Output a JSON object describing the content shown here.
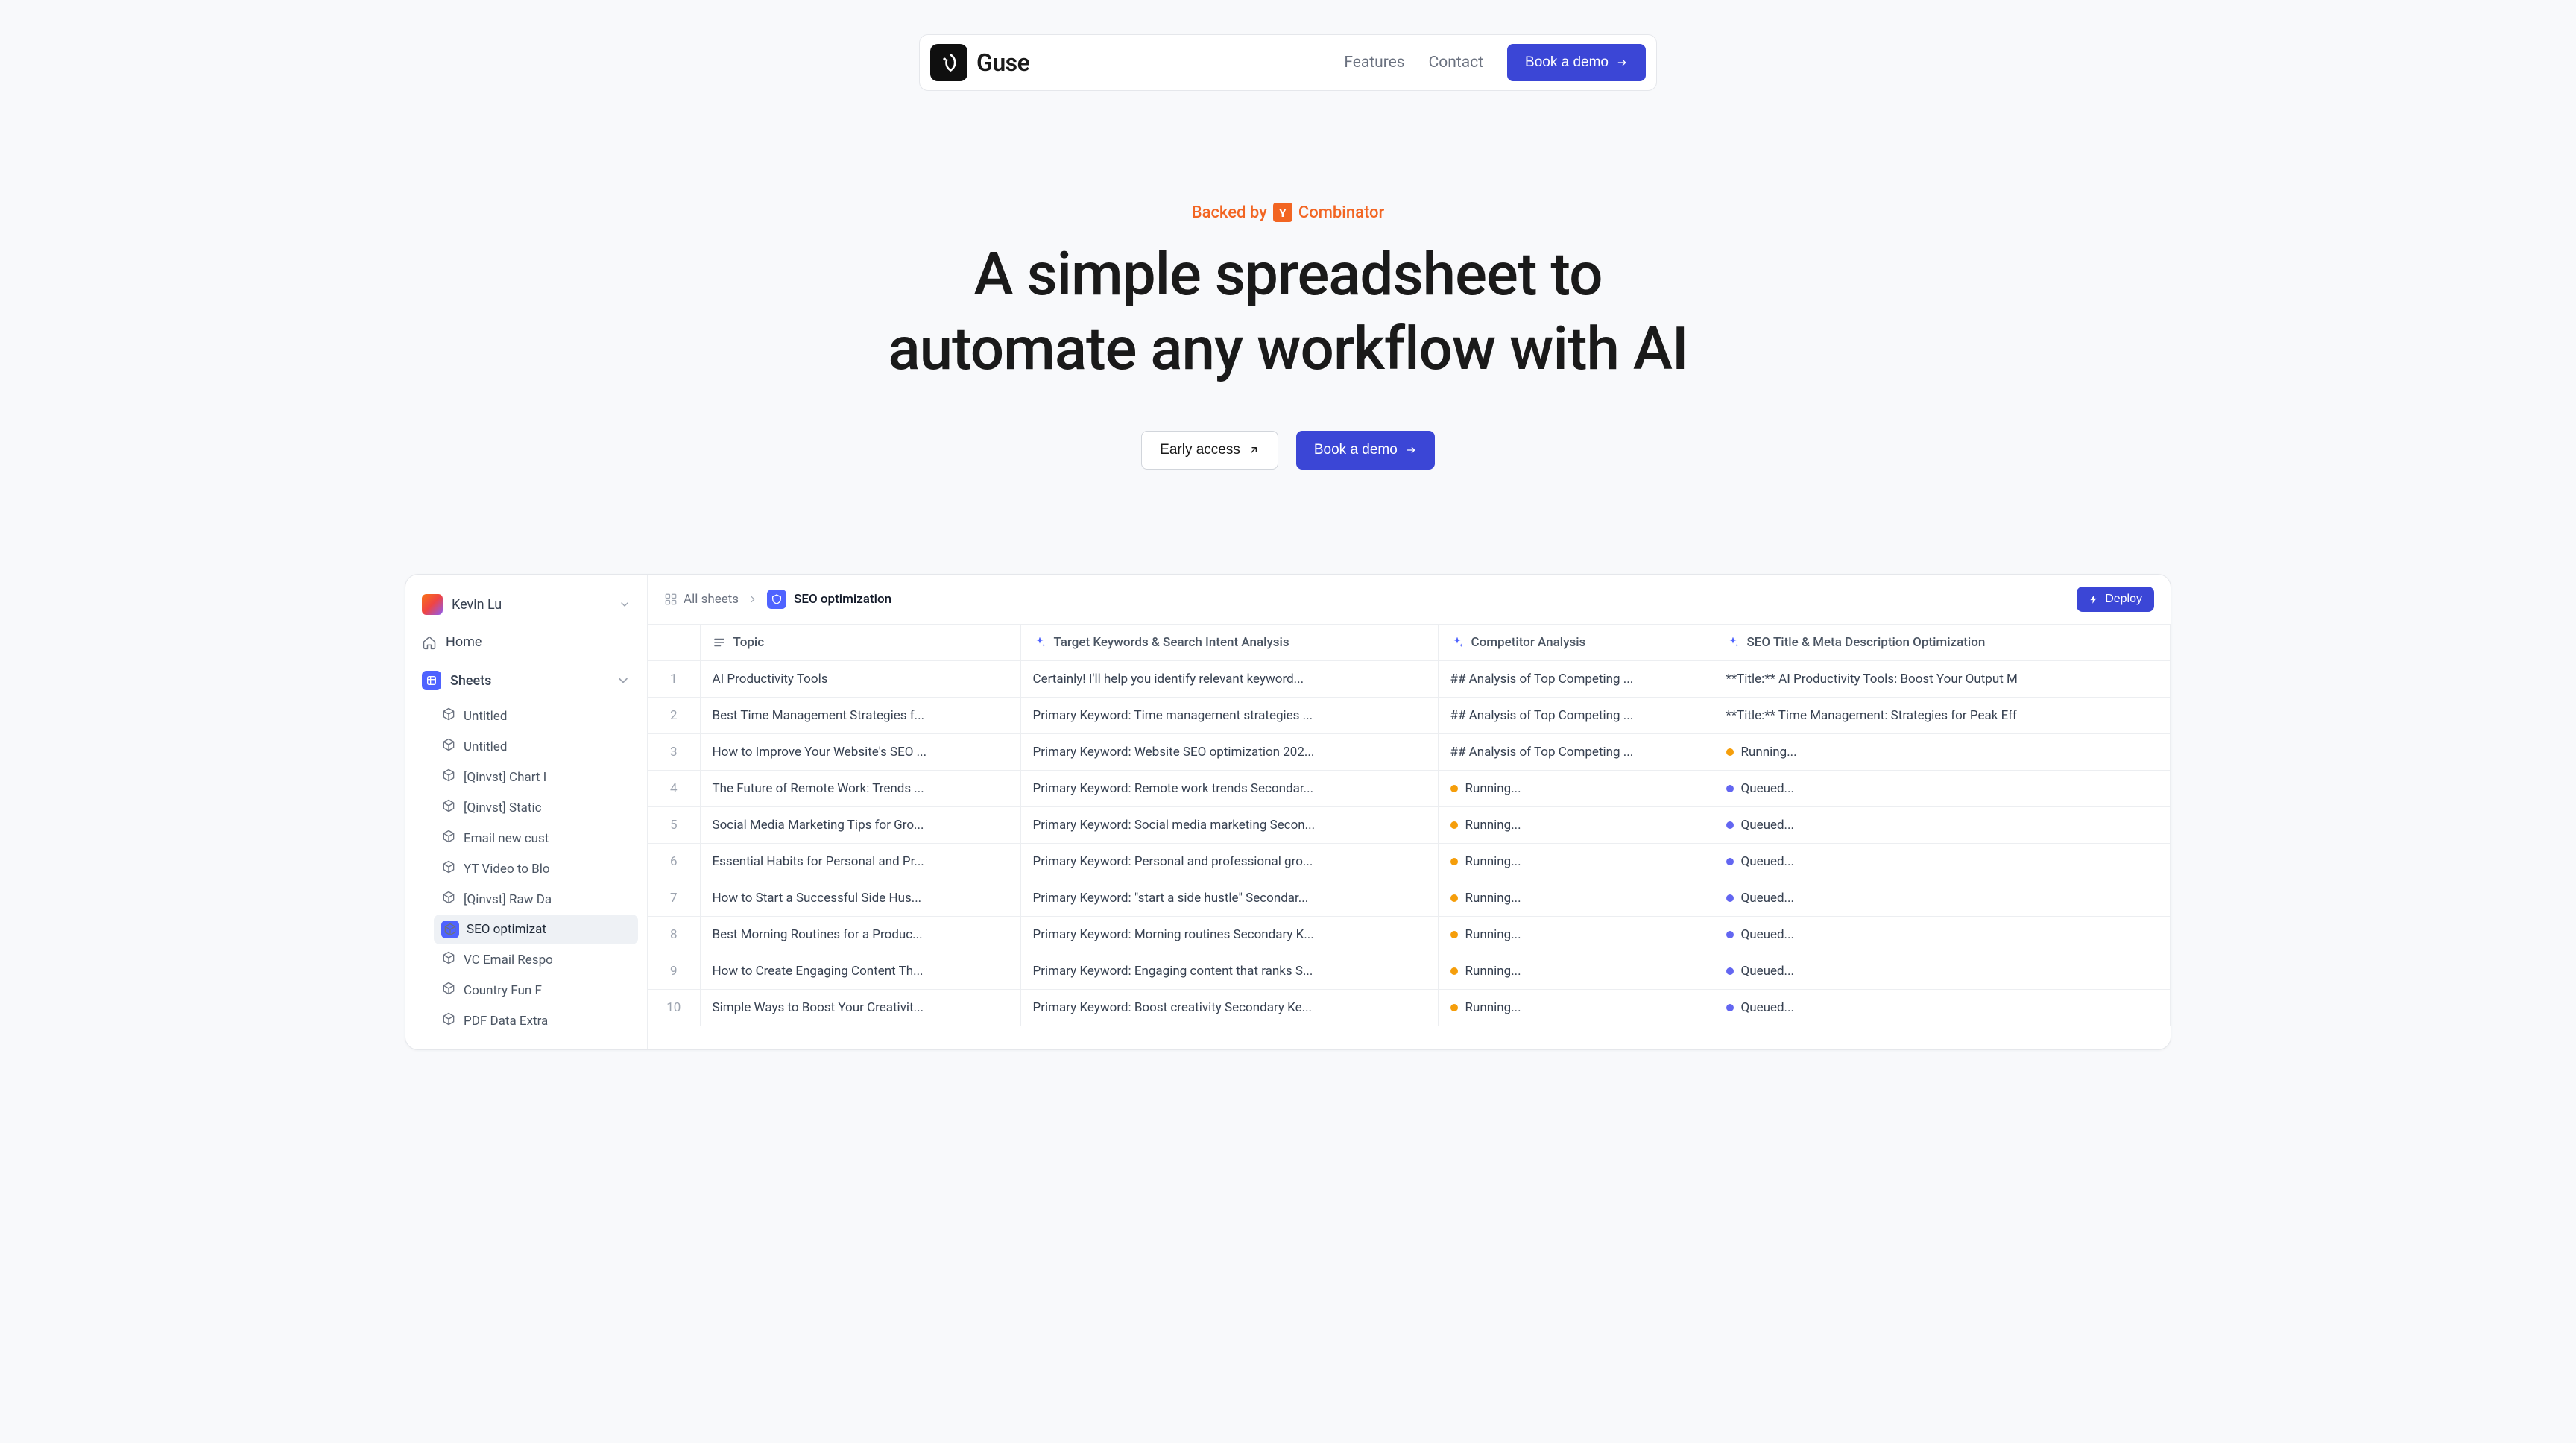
{
  "nav": {
    "brand": "Guse",
    "links": {
      "features": "Features",
      "contact": "Contact"
    },
    "book_demo": "Book a demo"
  },
  "hero": {
    "backed_prefix": "Backed by",
    "backed_company": "Combinator",
    "headline_l1": "A simple spreadsheet to",
    "headline_l2": "automate any workflow with AI",
    "early_access": "Early access",
    "book_demo": "Book a demo"
  },
  "app": {
    "user": "Kevin Lu",
    "nav_home": "Home",
    "nav_sheets": "Sheets",
    "sheets": [
      "Untitled",
      "Untitled",
      "[Qinvst] Chart I",
      "[Qinvst] Static",
      "Email new cust",
      "YT Video to Blo",
      "[Qinvst] Raw Da",
      "SEO optimizat",
      "VC Email Respo",
      "Country Fun F",
      "PDF Data Extra"
    ],
    "active_sheet_index": 7,
    "breadcrumb_all": "All sheets",
    "breadcrumb_current": "SEO optimization",
    "deploy": "Deploy",
    "columns": {
      "topic": "Topic",
      "keywords": "Target Keywords & Search Intent Analysis",
      "competitor": "Competitor Analysis",
      "seo": "SEO Title & Meta Description Optimization"
    },
    "status_running": "Running...",
    "status_queued": "Queued...",
    "rows": [
      {
        "n": "1",
        "topic": "AI Productivity Tools",
        "kw": "Certainly! I'll help you identify relevant keyword...",
        "comp_text": "## Analysis of Top Competing ...",
        "seo_text": "**Title:** AI Productivity Tools: Boost Your Output M"
      },
      {
        "n": "2",
        "topic": "Best Time Management Strategies f...",
        "kw": "Primary Keyword: Time management strategies ...",
        "comp_text": "## Analysis of Top Competing ...",
        "seo_text": "**Title:** Time Management: Strategies for Peak Eff"
      },
      {
        "n": "3",
        "topic": "How to Improve Your Website's SEO ...",
        "kw": "Primary Keyword: Website SEO optimization 202...",
        "comp_text": "## Analysis of Top Competing ...",
        "seo_status": "running"
      },
      {
        "n": "4",
        "topic": "The Future of Remote Work: Trends ...",
        "kw": "Primary Keyword: Remote work trends Secondar...",
        "comp_status": "running",
        "seo_status": "queued"
      },
      {
        "n": "5",
        "topic": "Social Media Marketing Tips for Gro...",
        "kw": "Primary Keyword: Social media marketing Secon...",
        "comp_status": "running",
        "seo_status": "queued"
      },
      {
        "n": "6",
        "topic": "Essential Habits for Personal and Pr...",
        "kw": "Primary Keyword: Personal and professional gro...",
        "comp_status": "running",
        "seo_status": "queued"
      },
      {
        "n": "7",
        "topic": "How to Start a Successful Side Hus...",
        "kw": "Primary Keyword: \"start a side hustle\" Secondar...",
        "comp_status": "running",
        "seo_status": "queued"
      },
      {
        "n": "8",
        "topic": "Best Morning Routines for a Produc...",
        "kw": "Primary Keyword: Morning routines Secondary K...",
        "comp_status": "running",
        "seo_status": "queued"
      },
      {
        "n": "9",
        "topic": "How to Create Engaging Content Th...",
        "kw": "Primary Keyword: Engaging content that ranks S...",
        "comp_status": "running",
        "seo_status": "queued"
      },
      {
        "n": "10",
        "topic": "Simple Ways to Boost Your Creativit...",
        "kw": "Primary Keyword: Boost creativity Secondary Ke...",
        "comp_status": "running",
        "seo_status": "queued"
      }
    ]
  }
}
